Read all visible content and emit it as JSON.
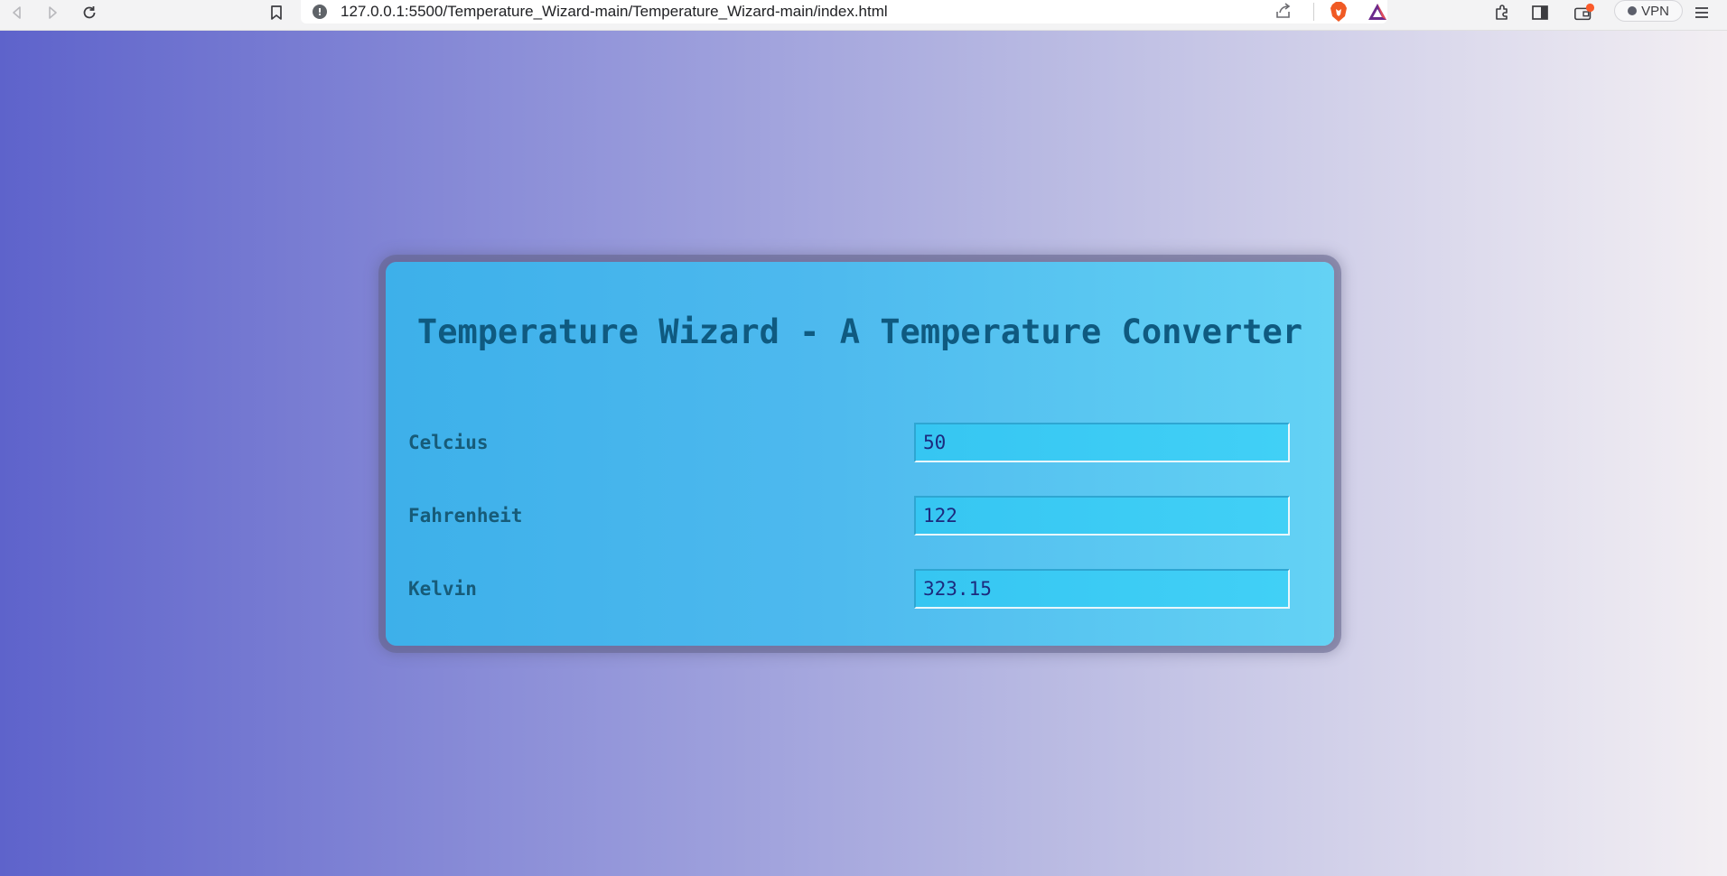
{
  "browser": {
    "url": "127.0.0.1:5500/Temperature_Wizard-main/Temperature_Wizard-main/index.html",
    "vpn_label": "VPN"
  },
  "page": {
    "title": "Temperature Wizard - A Temperature Converter",
    "fields": [
      {
        "label": "Celcius",
        "value": "50"
      },
      {
        "label": "Fahrenheit",
        "value": "122"
      },
      {
        "label": "Kelvin",
        "value": "323.15"
      }
    ]
  },
  "colors": {
    "page_gradient_start": "#5e63cb",
    "page_gradient_end": "#f3eff3",
    "card_start": "#3db0ea",
    "card_end": "#64d2f4",
    "title_color": "#0f5a80",
    "input_text": "#1c2a7e"
  }
}
